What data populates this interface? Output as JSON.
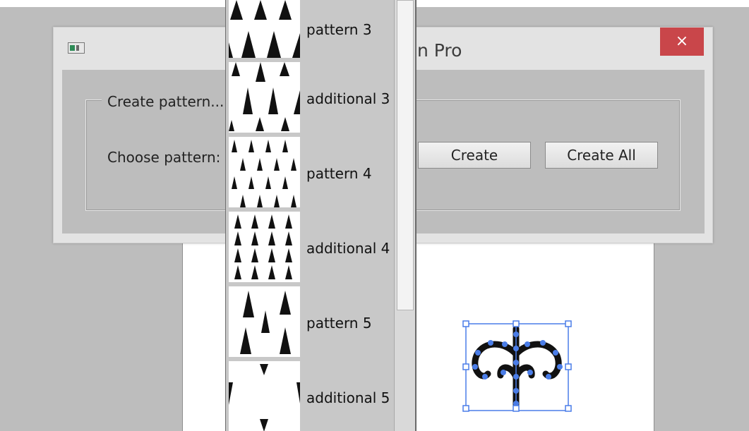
{
  "dialog": {
    "title": "n Pro",
    "close_label": "×",
    "group_title": "Create pattern...",
    "choose_label": "Choose pattern:",
    "create_label": "Create",
    "create_all_label": "Create All"
  },
  "dropdown": {
    "items": [
      {
        "label": "pattern 3"
      },
      {
        "label": "additional 3"
      },
      {
        "label": "pattern 4"
      },
      {
        "label": "additional 4"
      },
      {
        "label": "pattern 5"
      },
      {
        "label": "additional 5"
      }
    ]
  },
  "colors": {
    "close": "#c9464a",
    "selection": "#4a7de8",
    "artwork": "#111111"
  },
  "icons": [
    "window-icon",
    "close-icon"
  ]
}
